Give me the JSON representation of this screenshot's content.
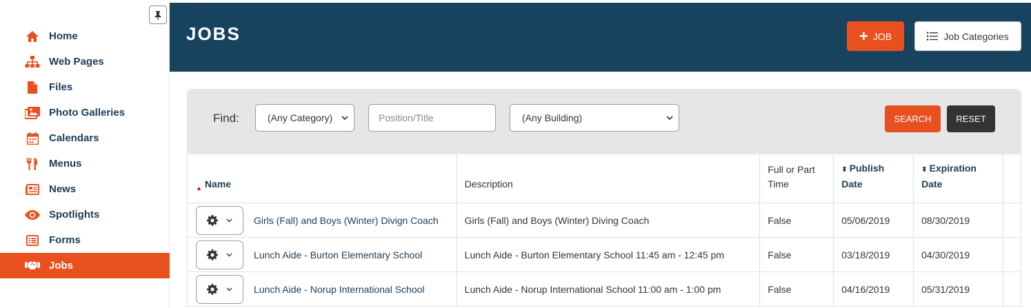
{
  "sidebar": {
    "items": [
      {
        "label": "Home",
        "icon": "home-icon"
      },
      {
        "label": "Web Pages",
        "icon": "sitemap-icon"
      },
      {
        "label": "Files",
        "icon": "file-icon"
      },
      {
        "label": "Photo Galleries",
        "icon": "images-icon"
      },
      {
        "label": "Calendars",
        "icon": "calendar-icon"
      },
      {
        "label": "Menus",
        "icon": "utensils-icon"
      },
      {
        "label": "News",
        "icon": "newspaper-icon"
      },
      {
        "label": "Spotlights",
        "icon": "eye-icon"
      },
      {
        "label": "Forms",
        "icon": "list-alt-icon"
      },
      {
        "label": "Jobs",
        "icon": "handshake-icon",
        "active": true
      }
    ]
  },
  "header": {
    "title": "JOBS",
    "add_job_label": "JOB",
    "job_categories_label": "Job Categories"
  },
  "filter": {
    "find_label": "Find:",
    "category_value": "(Any Category)",
    "position_placeholder": "Position/Title",
    "building_value": "(Any Building)",
    "search_label": "SEARCH",
    "reset_label": "RESET"
  },
  "table": {
    "columns": {
      "name": "Name",
      "description": "Description",
      "full_part_line1": "Full or Part",
      "full_part_line2": "Time",
      "publish_line1": "Publish",
      "publish_line2": "Date",
      "expiration_line1": "Expiration",
      "expiration_line2": "Date"
    },
    "rows": [
      {
        "name": "Girls (Fall) and Boys (Winter) Divign Coach",
        "description": "Girls (Fall) and Boys (Winter) Diving Coach",
        "full_part": "False",
        "publish": "05/06/2019",
        "expiration": "08/30/2019"
      },
      {
        "name": "Lunch Aide - Burton Elementary School",
        "description": "Lunch Aide - Burton Elementary School 11:45 am - 12:45 pm",
        "full_part": "False",
        "publish": "03/18/2019",
        "expiration": "04/30/2019"
      },
      {
        "name": "Lunch Aide - Norup International School",
        "description": "Lunch Aide - Norup International School 11:00 am - 1:00 pm",
        "full_part": "False",
        "publish": "04/16/2019",
        "expiration": "05/31/2019"
      }
    ]
  },
  "colors": {
    "accent": "#e8501f",
    "header_bg": "#18435e",
    "nav_text": "#1b3c55"
  }
}
